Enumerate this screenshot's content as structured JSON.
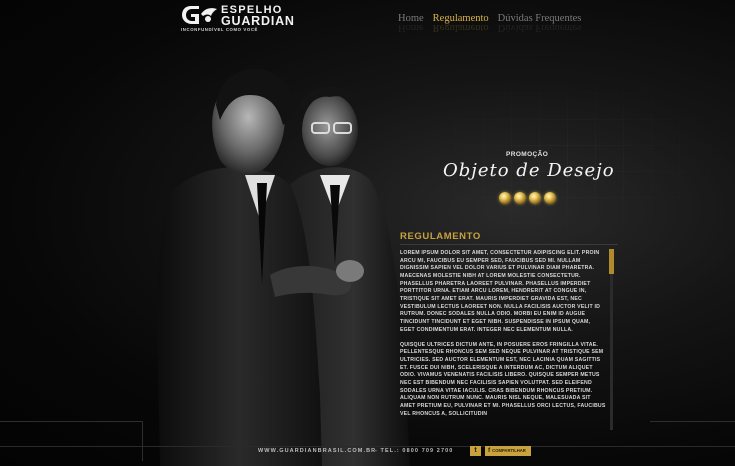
{
  "brand": {
    "top": "ESPELHO",
    "main": "GUARDIAN",
    "tagline": "INCONFUNDÍVEL COMO VOCÊ"
  },
  "nav": [
    {
      "label": "Home",
      "active": false
    },
    {
      "label": "Regulamento",
      "active": true
    },
    {
      "label": "Dúvidas Frequentes",
      "active": false
    }
  ],
  "promo": {
    "label": "PROMOÇÃO",
    "title": "Objeto de Desejo"
  },
  "regulamento": {
    "title": "REGULAMENTO",
    "p1": "LOREM IPSUM DOLOR SIT AMET, CONSECTETUR ADIPISCING ELIT. PROIN ARCU MI, FAUCIBUS EU SEMPER SED, FAUCIBUS SED MI. NULLAM DIGNISSIM SAPIEN VEL DOLOR VARIUS ET PULVINAR DIAM PHARETRA. MAECENAS MOLESTIE NIBH AT LOREM MOLESTIE CONSECTETUR. PHASELLUS PHARETRA LAOREET PULVINAR. PHASELLUS IMPERDIET PORTTITOR URNA. ETIAM ARCU LOREM, HENDRERIT AT CONGUE IN, TRISTIQUE SIT AMET ERAT. MAURIS IMPERDIET GRAVIDA EST, NEC VESTIBULUM LECTUS LAOREET NON. NULLA FACILISIS AUCTOR VELIT ID RUTRUM. DONEC SODALES NULLA ODIO. MORBI EU ENIM ID AUGUE TINCIDUNT TINCIDUNT ET EGET NIBH. SUSPENDISSE IN IPSUM QUAM, EGET CONDIMENTUM ERAT. INTEGER NEC ELEMENTUM NULLA.",
    "p2": "QUISQUE ULTRICES DICTUM ANTE, IN POSUERE EROS FRINGILLA VITAE. PELLENTESQUE RHONCUS SEM SED NEQUE PULVINAR AT TRISTIQUE SEM ULTRICIES. SED AUCTOR ELEMENTUM EST, NEC LACINIA QUAM SAGITTIS ET. FUSCE DUI NIBH, SCELERISQUE A INTERDUM AC, DICTUM ALIQUET ODIO. VIVAMUS VENENATIS FACILISIS LIBERO. QUISQUE SEMPER METUS NEC EST BIBENDUM NEC FACILISIS SAPIEN VOLUTPAT. SED ELEIFEND SODALES URNA VITAE IACULIS. CRAS BIBENDUM RHONCUS PRETIUM. ALIQUAM NON RUTRUM NUNC. MAURIS NISL NEQUE, MALESUADA SIT AMET PRETIUM EU, PULVINAR ET MI. PHASELLUS ORCI LECTUS, FAUCIBUS VEL RHONCUS A, SOLLICITUDIN"
  },
  "footer": {
    "url": "WWW.GUARDIANBRASIL.COM.BR",
    "tel": "- TEL.: 0800 709 2700",
    "twitter_glyph": "t",
    "facebook_glyph": "f",
    "share_label": "COMPARTILHAR"
  },
  "colors": {
    "accent": "#c9a23d",
    "background": "#050505",
    "text": "#d8d8d8"
  },
  "icons": [
    "guardian-logo-icon",
    "diamond-icon",
    "twitter-icon",
    "facebook-icon"
  ]
}
